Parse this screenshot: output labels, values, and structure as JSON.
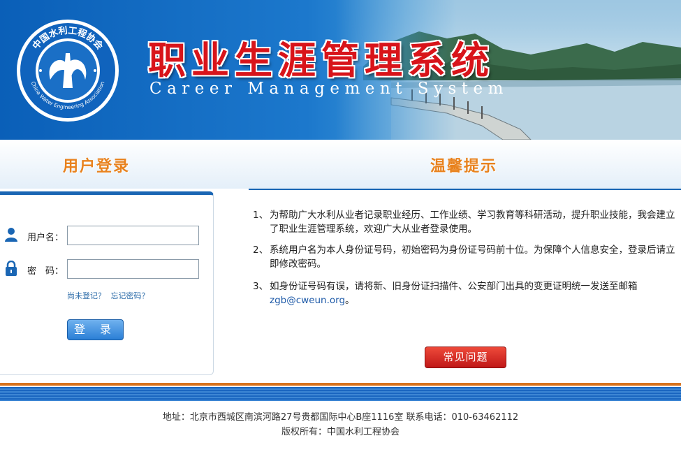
{
  "header": {
    "logo_ring_text": "中国水利工程协会",
    "logo_ring_text_en": "China Water Engineering Association",
    "title_cn": "职业生涯管理系统",
    "title_en": "Career Management System"
  },
  "login": {
    "section_title": "用户登录",
    "username_label": "用户名：",
    "username_value": "",
    "password_label": "密　码：",
    "password_value": "",
    "register_link": "尚未登记？",
    "forgot_link": "忘记密码？",
    "login_button": "登 录"
  },
  "tips": {
    "section_title": "温馨提示",
    "items": [
      {
        "num": "1、",
        "text": "为帮助广大水利从业者记录职业经历、工作业绩、学习教育等科研活动，提升职业技能，我会建立了职业生涯管理系统，欢迎广大从业者登录使用。"
      },
      {
        "num": "2、",
        "text": "系统用户名为本人身份证号码，初始密码为身份证号码前十位。为保障个人信息安全，登录后请立即修改密码。"
      },
      {
        "num": "3、",
        "text": "如身份证号码有误，请将新、旧身份证扫描件、公安部门出具的变更证明统一发送至邮箱",
        "email": "zgb@cweun.org",
        "suffix": "。"
      }
    ],
    "faq_button": "常见问题"
  },
  "footer": {
    "address": "地址：北京市西城区南滨河路27号贵都国际中心B座1116室 联系电话：010-63462112",
    "copyright": "版权所有：中国水利工程协会"
  },
  "colors": {
    "header_blue": "#0a5fb8",
    "title_red": "#d8141a",
    "section_orange": "#e8821e",
    "accent_blue": "#1a66b4",
    "faq_red": "#c01818"
  }
}
